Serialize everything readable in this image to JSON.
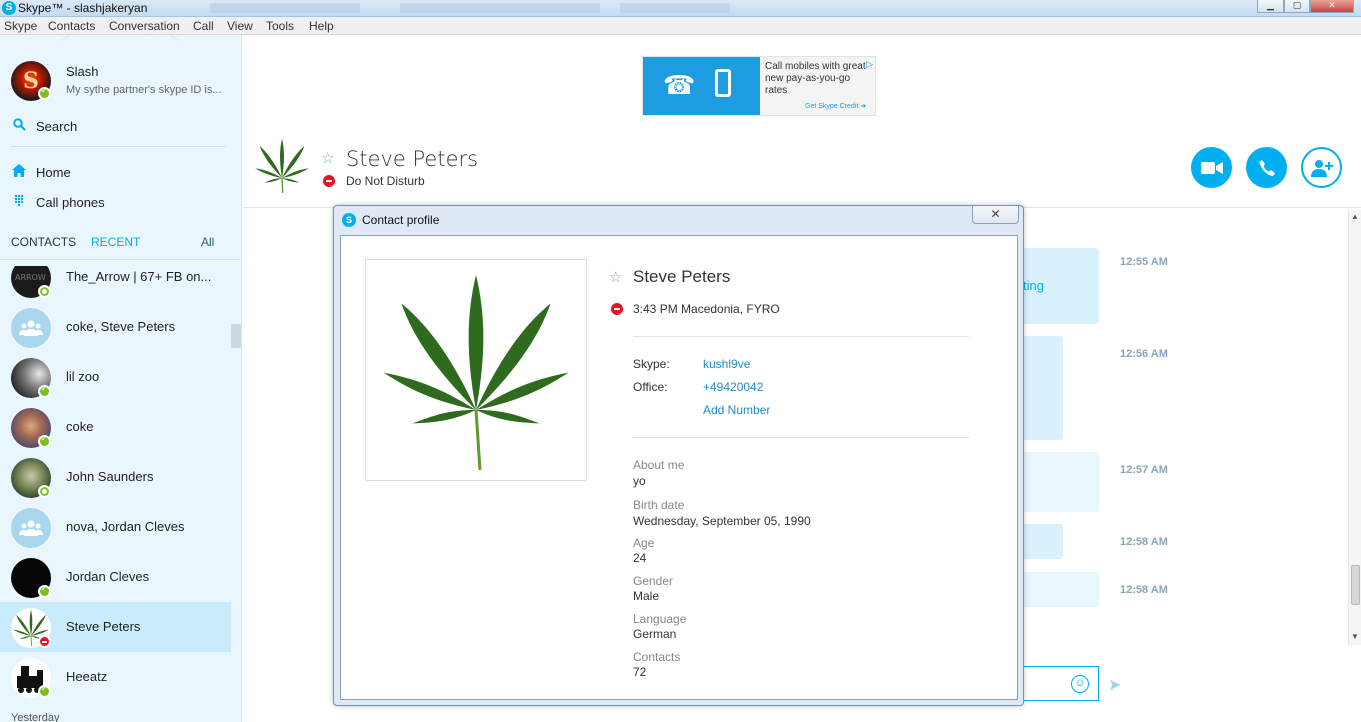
{
  "window": {
    "title": "Skype™ - slashjakeryan",
    "controls": [
      "minimize-icon",
      "maximize-icon",
      "close-icon"
    ]
  },
  "menu": [
    "Skype",
    "Contacts",
    "Conversation",
    "Call",
    "View",
    "Tools",
    "Help"
  ],
  "me": {
    "name": "Slash",
    "mood": "My sythe partner's skype ID is...",
    "avatar_letter": "S"
  },
  "nav": {
    "search": "Search",
    "home": "Home",
    "call_phones": "Call phones"
  },
  "tabs": {
    "contacts": "CONTACTS",
    "recent": "RECENT",
    "filter": "All"
  },
  "contacts": [
    {
      "name": "The_Arrow | 67+ FB on...",
      "status": "away"
    },
    {
      "name": "coke, Steve Peters",
      "status": "group"
    },
    {
      "name": "lil zoo",
      "status": "online"
    },
    {
      "name": "coke",
      "status": "online"
    },
    {
      "name": "John Saunders",
      "status": "away"
    },
    {
      "name": "nova, Jordan Cleves",
      "status": "group"
    },
    {
      "name": "Jordan Cleves",
      "status": "online"
    },
    {
      "name": "Steve Peters",
      "status": "dnd",
      "selected": true
    },
    {
      "name": "Heeatz",
      "status": "online"
    }
  ],
  "section_yesterday": "Yesterday",
  "ad": {
    "text": "Call mobiles with great new pay-as-you-go rates",
    "cta": "Get Skype Credit",
    "accent": "#1e9ce0"
  },
  "conversation": {
    "name": "Steve Peters",
    "status": "Do Not Disturb",
    "actions": [
      "video-call-icon",
      "call-icon",
      "add-contact-icon"
    ],
    "fragment": "ting",
    "timestamps": [
      "12:55 AM",
      "12:56 AM",
      "12:57 AM",
      "12:58 AM",
      "12:58 AM"
    ]
  },
  "profile_dialog": {
    "title": "Contact profile",
    "name": "Steve Peters",
    "local_time_location": "3:43 PM Macedonia, FYRO",
    "skype_label": "Skype:",
    "skype_value": "kushl9ve",
    "office_label": "Office:",
    "office_value": "+49420042",
    "add_number": "Add Number",
    "details": [
      {
        "label": "About me",
        "value": "yo"
      },
      {
        "label": "Birth date",
        "value": "Wednesday, September 05, 1990"
      },
      {
        "label": "Age",
        "value": "24"
      },
      {
        "label": "Gender",
        "value": "Male"
      },
      {
        "label": "Language",
        "value": "German"
      },
      {
        "label": "Contacts",
        "value": "72"
      }
    ]
  },
  "colors": {
    "skype_blue": "#00aff0",
    "sidebar_bg": "#eaf6fd",
    "selected_bg": "#c9ebfb",
    "dnd_red": "#e81123",
    "online_green": "#7cbf1a"
  }
}
